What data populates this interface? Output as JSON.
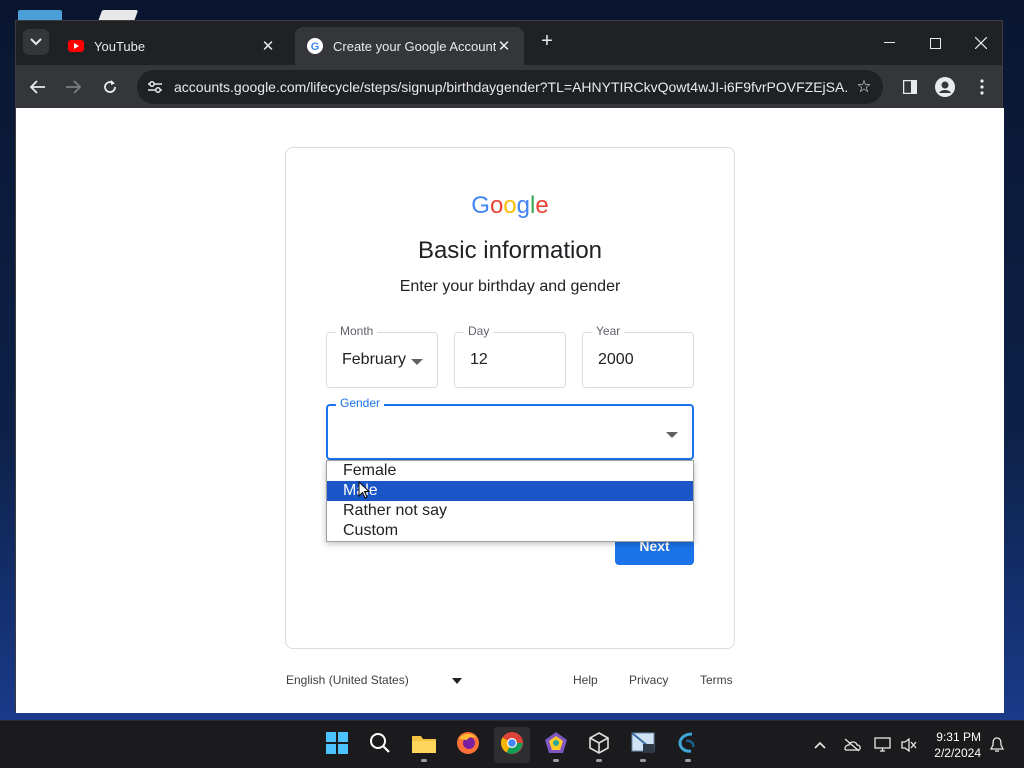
{
  "browser": {
    "tabs": [
      {
        "title": "YouTube",
        "favicon": "youtube-icon"
      },
      {
        "title": "Create your Google Account",
        "favicon": "google-icon"
      }
    ],
    "url": "accounts.google.com/lifecycle/steps/signup/birthdaygender?TL=AHNYTIRCkvQowt4wJI-i6F9fvrPOVFZEjSA..."
  },
  "page": {
    "logo": "Google",
    "title": "Basic information",
    "subtitle": "Enter your birthday and gender",
    "month": {
      "label": "Month",
      "value": "February"
    },
    "day": {
      "label": "Day",
      "value": "12"
    },
    "year": {
      "label": "Year",
      "value": "2000"
    },
    "gender": {
      "label": "Gender",
      "value": "",
      "options": [
        "Female",
        "Male",
        "Rather not say",
        "Custom"
      ],
      "highlighted": "Male"
    },
    "next_label": "Next",
    "footer": {
      "language": "English (United States)",
      "help": "Help",
      "privacy": "Privacy",
      "terms": "Terms"
    }
  },
  "taskbar": {
    "time": "9:31 PM",
    "date": "2/2/2024"
  },
  "colors": {
    "google_blue": "#4285F4",
    "google_red": "#EA4335",
    "google_yellow": "#FBBC05",
    "google_green": "#34A853",
    "button_blue": "#1a73e8",
    "selected_option": "#1a56c8"
  }
}
